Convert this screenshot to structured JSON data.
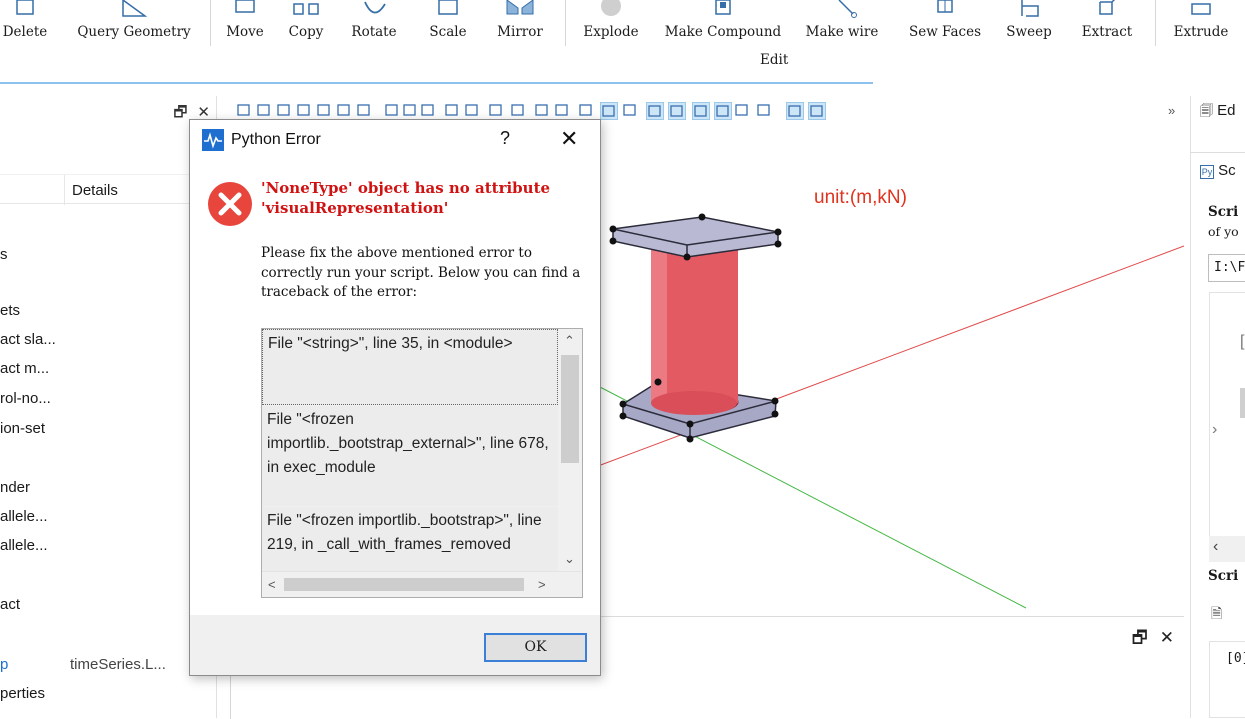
{
  "ribbon": {
    "tools": [
      {
        "id": "delete",
        "label": "Delete"
      },
      {
        "id": "query-geometry",
        "label": "Query Geometry"
      },
      {
        "id": "move",
        "label": "Move"
      },
      {
        "id": "copy",
        "label": "Copy"
      },
      {
        "id": "rotate",
        "label": "Rotate"
      },
      {
        "id": "scale",
        "label": "Scale"
      },
      {
        "id": "mirror",
        "label": "Mirror"
      },
      {
        "id": "explode",
        "label": "Explode"
      },
      {
        "id": "make-compound",
        "label": "Make Compound"
      },
      {
        "id": "make-wire",
        "label": "Make wire"
      },
      {
        "id": "sew-faces",
        "label": "Sew Faces"
      },
      {
        "id": "sweep",
        "label": "Sweep"
      },
      {
        "id": "extract",
        "label": "Extract"
      },
      {
        "id": "extrude",
        "label": "Extrude"
      }
    ],
    "group_label": "Edit"
  },
  "left_panel": {
    "column_header": "Details",
    "items": [
      {
        "text": "s",
        "detail": ""
      },
      {
        "text": "ets",
        "detail": ""
      },
      {
        "text": "act sla...",
        "detail": ""
      },
      {
        "text": "act m...",
        "detail": ""
      },
      {
        "text": "rol-no...",
        "detail": ""
      },
      {
        "text": "ion-set",
        "detail": ""
      },
      {
        "text": "nder",
        "detail": ""
      },
      {
        "text": "allele...",
        "detail": ""
      },
      {
        "text": "allele...",
        "detail": ""
      },
      {
        "text": "act",
        "detail": ""
      },
      {
        "text": "p",
        "detail": "timeSeries.L..."
      },
      {
        "text": "perties",
        "detail": ""
      }
    ]
  },
  "viewport": {
    "unit_label": "unit:(m,kN)"
  },
  "right_panel": {
    "tab_edit": "Ed",
    "tab_script": "Sc",
    "script_title": "Scri",
    "script_sub": "of yo",
    "path_value": "I:\\F",
    "script_title2": "Scri",
    "output_value": "[0]"
  },
  "dialog": {
    "title": "Python Error",
    "help": "?",
    "close": "✕",
    "error_message": "'NoneType' object has no attribute 'visualRepresentation'",
    "hint": "Please fix the above mentioned error to correctly run your script. Below you can find a traceback of the error:",
    "traceback": [
      "File \"<string>\", line 35, in <module>",
      "File \"<frozen importlib._bootstrap_external>\", line 678, in exec_module",
      "File \"<frozen importlib._bootstrap>\", line 219, in _call_with_frames_removed"
    ],
    "ok_label": "OK"
  },
  "colors": {
    "accent": "#3c7fd6",
    "error_red": "#d11212",
    "unit_label": "#e0321e",
    "pier": "#e45a63",
    "plate": "#b9b9d3"
  }
}
